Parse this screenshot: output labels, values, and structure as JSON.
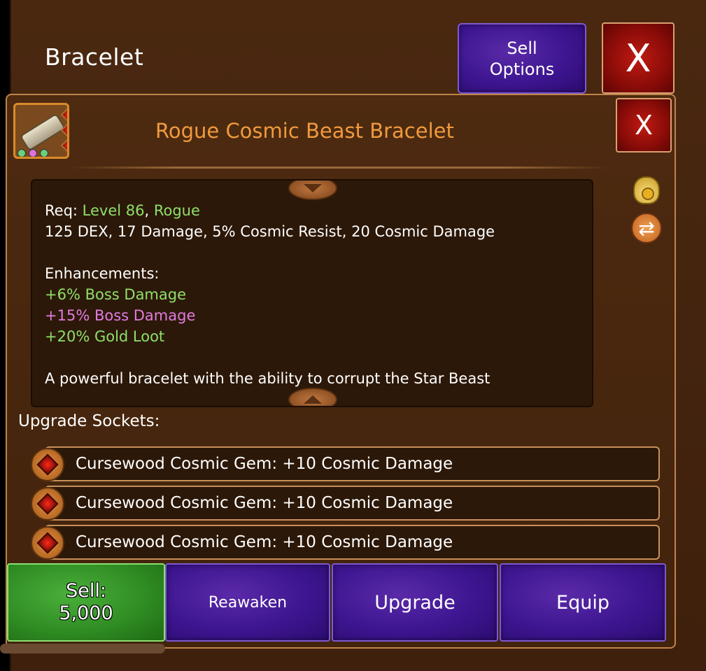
{
  "header": {
    "title": "Bracelet",
    "sell_options_line1": "Sell",
    "sell_options_line2": "Options",
    "close_label": "X"
  },
  "item": {
    "name": "Rogue Cosmic Beast Bracelet",
    "close_label": "X",
    "req_label": "Req: ",
    "req_level": "Level 86",
    "req_sep": ", ",
    "req_class": "Rogue",
    "stats": "125 DEX, 17 Damage, 5% Cosmic Resist, 20 Cosmic Damage",
    "enhancements_label": "Enhancements:",
    "enhancements": [
      {
        "text": "+6% Boss Damage",
        "color": "#8ee06a"
      },
      {
        "text": "+15% Boss Damage",
        "color": "#e07ce0"
      },
      {
        "text": "+20% Gold Loot",
        "color": "#8ee06a"
      }
    ],
    "description": "A powerful bracelet with the ability to corrupt the Star Beast",
    "icons": [
      "bracelet-icon",
      "loot-bag-icon",
      "swap-icon"
    ]
  },
  "sockets": {
    "label": "Upgrade Sockets:",
    "items": [
      "Cursewood Cosmic Gem: +10 Cosmic Damage",
      "Cursewood Cosmic Gem: +10 Cosmic Damage",
      "Cursewood Cosmic Gem: +10 Cosmic Damage"
    ]
  },
  "actions": {
    "sell_label": "Sell:",
    "sell_price": "5,000",
    "reawaken": "Reawaken",
    "upgrade": "Upgrade",
    "equip": "Equip"
  },
  "colors": {
    "title_orange": "#f09a3e",
    "green": "#8ee06a",
    "pink": "#e07ce0",
    "purple_button": "#3d1590",
    "red_button": "#8a0c08",
    "sell_green": "#2e8a22"
  }
}
